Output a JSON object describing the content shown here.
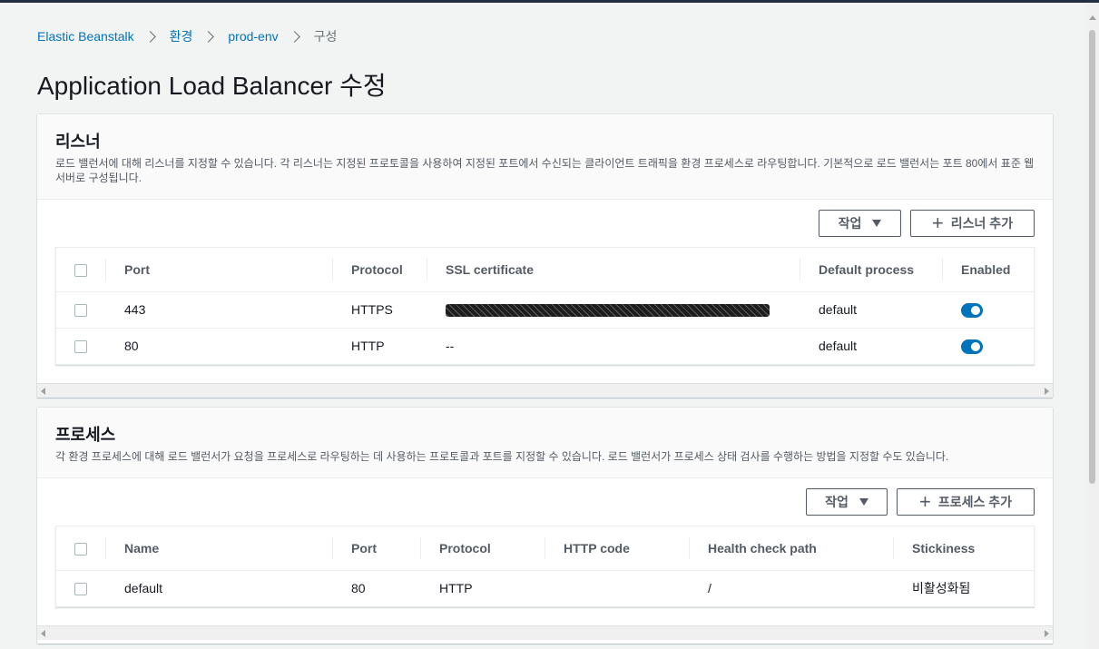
{
  "breadcrumb": {
    "items": [
      "Elastic Beanstalk",
      "환경",
      "prod-env"
    ],
    "current": "구성"
  },
  "page_title": "Application Load Balancer 수정",
  "listeners": {
    "title": "리스너",
    "description": "로드 밸런서에 대해 리스너를 지정할 수 있습니다. 각 리스너는 지정된 프로토콜을 사용하여 지정된 포트에서 수신되는 클라이언트 트래픽을 환경 프로세스로 라우팅합니다. 기본적으로 로드 밸런서는 포트 80에서 표준 웹 서버로 구성됩니다.",
    "actions_label": "작업",
    "add_label": "리스너 추가",
    "columns": [
      "Port",
      "Protocol",
      "SSL certificate",
      "Default process",
      "Enabled"
    ],
    "rows": [
      {
        "port": "443",
        "protocol": "HTTPS",
        "ssl": "",
        "process": "default",
        "enabled": true
      },
      {
        "port": "80",
        "protocol": "HTTP",
        "ssl": "--",
        "process": "default",
        "enabled": true
      }
    ]
  },
  "processes": {
    "title": "프로세스",
    "description": "각 환경 프로세스에 대해 로드 밸런서가 요청을 프로세스로 라우팅하는 데 사용하는 프로토콜과 포트를 지정할 수 있습니다. 로드 밸런서가 프로세스 상태 검사를 수행하는 방법을 지정할 수도 있습니다.",
    "actions_label": "작업",
    "add_label": "프로세스 추가",
    "columns": [
      "Name",
      "Port",
      "Protocol",
      "HTTP code",
      "Health check path",
      "Stickiness"
    ],
    "rows": [
      {
        "name": "default",
        "port": "80",
        "protocol": "HTTP",
        "http_code": "",
        "path": "/",
        "stickiness": "비활성화됨"
      }
    ]
  },
  "colors": {
    "accent": "#0073bb",
    "background": "#f2f3f3"
  }
}
